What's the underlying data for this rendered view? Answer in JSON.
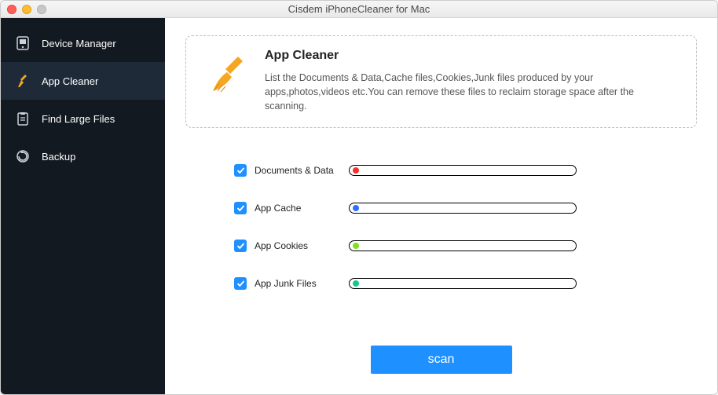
{
  "window": {
    "title": "Cisdem iPhoneCleaner for Mac"
  },
  "sidebar": {
    "items": [
      {
        "label": "Device Manager",
        "icon": "device-icon"
      },
      {
        "label": "App Cleaner",
        "icon": "broom-icon"
      },
      {
        "label": "Find Large Files",
        "icon": "clipboard-icon"
      },
      {
        "label": "Backup",
        "icon": "backup-icon"
      }
    ],
    "active_index": 1
  },
  "info": {
    "heading": "App Cleaner",
    "description": "List the Documents & Data,Cache files,Cookies,Junk files produced by your apps,photos,videos etc.You can remove these files to reclaim storage space after the scanning."
  },
  "categories": [
    {
      "label": "Documents & Data",
      "checked": true,
      "dot_color": "#ff2d2d"
    },
    {
      "label": "App Cache",
      "checked": true,
      "dot_color": "#2d6dff"
    },
    {
      "label": "App Cookies",
      "checked": true,
      "dot_color": "#7fe01d"
    },
    {
      "label": "App Junk Files",
      "checked": true,
      "dot_color": "#11c98b"
    }
  ],
  "scan_button": {
    "label": "scan"
  }
}
